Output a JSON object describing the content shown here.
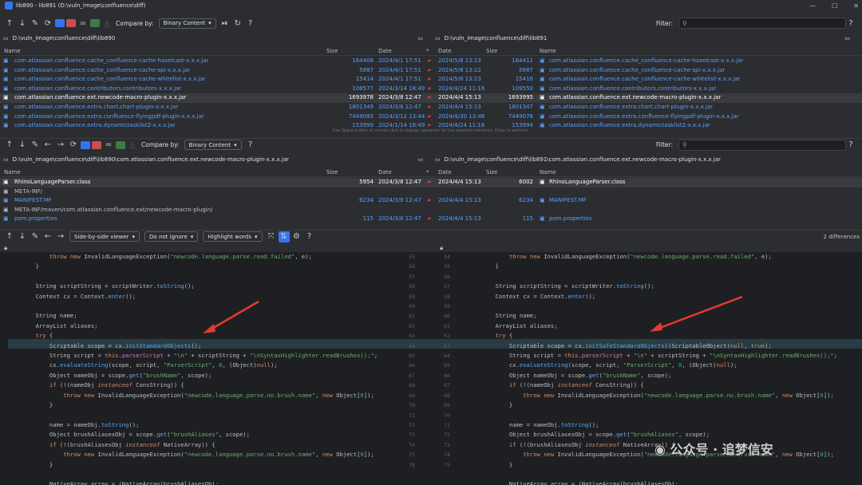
{
  "window": {
    "title": "lib890 - lib891 (D:\\vuln_image\\confluence\\diff)",
    "min": "—",
    "max": "☐",
    "close": "✕"
  },
  "top": {
    "compare_label": "Compare by:",
    "compare_value": "Binary Content",
    "filter_label": "Filter:",
    "left_path": "D:\\vuln_image\\confluence\\diff\\lib890",
    "right_path": "D:\\vuln_image\\confluence\\diff\\lib891",
    "headers": {
      "name": "Name",
      "size": "Size",
      "date": "Date",
      "star": "*"
    },
    "rows": [
      {
        "l": "com.atlassian.confluence.cache_confluence-cache-hazelcast-x.x.x.jar",
        "ls": "164408",
        "ld": "2024/4/1 17:51",
        "rd": "2024/5/8 13:23",
        "rs": "164411",
        "r": "com.atlassian.confluence.cache_confluence-cache-hazelcast-x.x.x.jar"
      },
      {
        "l": "com.atlassian.confluence.cache_confluence-cache-spi-x.x.x.jar",
        "ls": "5887",
        "ld": "2024/4/1 17:51",
        "rd": "2024/5/8 13:22",
        "rs": "5887",
        "r": "com.atlassian.confluence.cache_confluence-cache-spi-x.x.x.jar"
      },
      {
        "l": "com.atlassian.confluence.cache_confluence-cache-whitelist-x.x.x.jar",
        "ls": "15414",
        "ld": "2024/4/1 17:51",
        "rd": "2024/5/8 13:23",
        "rs": "15416",
        "r": "com.atlassian.confluence.cache_confluence-cache-whitelist-x.x.x.jar"
      },
      {
        "l": "com.atlassian.confluence.contributors.contributors-x.x.x.jar",
        "ls": "108577",
        "ld": "2024/3/14 18:49",
        "rd": "2024/4/24 11:16",
        "rs": "109550",
        "r": "com.atlassian.confluence.contributors.contributors-x.x.x.jar"
      },
      {
        "l": "com.atlassian.confluence.ext.newcode-macro-plugin-x.x.x.jar",
        "ls": "1693978",
        "ld": "2024/3/8 12:47",
        "rd": "2024/4/4 15:13",
        "rs": "1693995",
        "r": "com.atlassian.confluence.ext.newcode-macro-plugin-x.x.x.jar"
      },
      {
        "l": "com.atlassian.confluence.extra.chart.chart-plugin-x.x.x.jar",
        "ls": "1801349",
        "ld": "2024/3/8 12:47",
        "rd": "2024/4/4 15:13",
        "rs": "1801347",
        "r": "com.atlassian.confluence.extra.chart.chart-plugin-x.x.x.jar"
      },
      {
        "l": "com.atlassian.confluence.extra.confluence-flyingpdf-plugin-x.x.x.jar",
        "ls": "7449093",
        "ld": "2024/3/12 13:44",
        "rd": "2024/4/30 13:46",
        "rs": "7449078",
        "r": "com.atlassian.confluence.extra.confluence-flyingpdf-plugin-x.x.x.jar"
      },
      {
        "l": "com.atlassian.confluence.extra.dynamictasklist2-x.x.x.jar",
        "ls": "153999",
        "ld": "2024/1/14 18:49",
        "rd": "2024/4/24 11:16",
        "rs": "153994",
        "r": "com.atlassian.confluence.extra.dynamictasklist2-x.x.x.jar"
      }
    ],
    "hint": "Use Space button or mouse click to change operation for the selected elements. Enter to perform."
  },
  "mid": {
    "compare_label": "Compare by:",
    "compare_value": "Binary Content",
    "filter_label": "Filter:",
    "left_path": "D:\\vuln_image\\confluence\\diff\\lib890\\com.atlassian.confluence.ext.newcode-macro-plugin-x.x.x.jar",
    "right_path": "D:\\vuln_image\\confluence\\diff\\lib891\\com.atlassian.confluence.ext.newcode-macro-plugin-x.x.x.jar",
    "rows": [
      {
        "l": "RhinoLanguageParser.class",
        "ls": "5954",
        "ld": "2024/3/8 12:47",
        "rd": "2024/4/4 15:13",
        "rs": "6002",
        "r": "RhinoLanguageParser.class"
      },
      {
        "l": "META-INF/",
        "ls": "",
        "ld": "",
        "rd": "",
        "rs": "",
        "r": ""
      },
      {
        "l": "MANIFEST.MF",
        "ls": "6234",
        "ld": "2024/3/8 12:47",
        "rd": "2024/4/4 15:13",
        "rs": "6234",
        "r": "MANIFEST.MF"
      },
      {
        "l": "META-INF/maven/com.atlassian.confluence.ext/newcode-macro-plugin/",
        "ls": "",
        "ld": "",
        "rd": "",
        "rs": "",
        "r": ""
      },
      {
        "l": "pom.properties",
        "ls": "115",
        "ld": "2024/3/8 12:47",
        "rd": "2024/4/4 15:13",
        "rs": "115",
        "r": "pom.properties"
      }
    ]
  },
  "diff": {
    "viewer": "Side-by-side viewer",
    "ignore": "Do not ignore",
    "highlight": "Highlight words",
    "count": "2 differences",
    "left_nums": [
      "",
      "",
      "",
      "",
      "",
      "",
      "",
      "",
      "",
      "",
      "",
      "",
      "",
      "",
      "",
      "",
      "",
      "",
      "",
      "",
      "",
      ""
    ],
    "mid_left": [
      "55",
      "56",
      "57",
      "58",
      "59",
      "60",
      "61",
      "62",
      "63",
      "64",
      "65",
      "66",
      "67",
      "68",
      "69",
      "70",
      "71",
      "72",
      "73",
      "74",
      "75",
      "76"
    ],
    "mid_right": [
      "54",
      "55",
      "56",
      "57",
      "58",
      "59",
      "60",
      "61",
      "62",
      "63",
      "64",
      "65",
      "66",
      "67",
      "68",
      "69",
      "70",
      "71",
      "72",
      "73",
      "74",
      "75"
    ],
    "watermark": "公众号 · 追梦信安"
  },
  "colors": {
    "accent": "#3574f0",
    "diff_red": "#e84b4b",
    "changed_bg": "#293c44"
  }
}
